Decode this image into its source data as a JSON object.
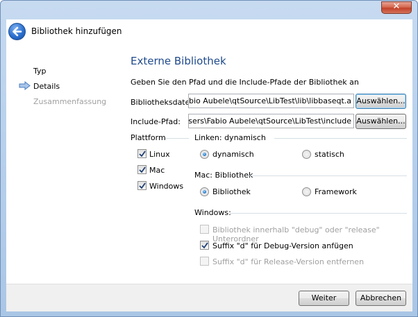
{
  "window": {
    "close_glyph": "✕"
  },
  "header": {
    "back_icon": "back-arrow-icon",
    "title": "Bibliothek hinzufügen"
  },
  "steps": [
    {
      "label": "Typ"
    },
    {
      "label": "Details"
    },
    {
      "label": "Zusammenfassung"
    }
  ],
  "page": {
    "title": "Externe Bibliothek",
    "subtitle": "Geben Sie den Pfad und die Include-Pfade der Bibliothek an",
    "library_file": {
      "label": "Bibliotheksdatei:",
      "value": "C:\\Users\\Fabio Aubele\\qtSource\\LibTest\\lib\\libbaseqt.a",
      "button": "Auswählen..."
    },
    "include_path": {
      "label": "Include-Pfad:",
      "value": "C:\\Users\\Fabio Aubele\\qtSource\\LibTest\\include",
      "button": "Auswählen..."
    },
    "platform": {
      "label": "Plattform",
      "options": [
        {
          "label": "Linux",
          "checked": true
        },
        {
          "label": "Mac",
          "checked": true
        },
        {
          "label": "Windows",
          "checked": true
        }
      ]
    },
    "linking": {
      "label": "Linken: dynamisch",
      "options": [
        {
          "label": "dynamisch",
          "selected": true
        },
        {
          "label": "statisch",
          "selected": false
        }
      ]
    },
    "mac": {
      "label": "Mac: Bibliothek",
      "options": [
        {
          "label": "Bibliothek",
          "selected": true
        },
        {
          "label": "Framework",
          "selected": false
        }
      ]
    },
    "windows": {
      "label": "Windows:",
      "options": [
        {
          "label": "Bibliothek innerhalb \"debug\" oder \"release\" Unterordner",
          "checked": false,
          "enabled": false
        },
        {
          "label": "Suffix \"d\" für Debug-Version anfügen",
          "checked": true,
          "enabled": true
        },
        {
          "label": "Suffix \"d\" für Release-Version entfernen",
          "checked": false,
          "enabled": false
        }
      ]
    }
  },
  "footer": {
    "next": "Weiter",
    "cancel": "Abbrechen"
  },
  "colors": {
    "accent_title": "#1f4a8c",
    "disabled_text": "#a0a0a0",
    "title_bar": "#b9d1ec"
  }
}
